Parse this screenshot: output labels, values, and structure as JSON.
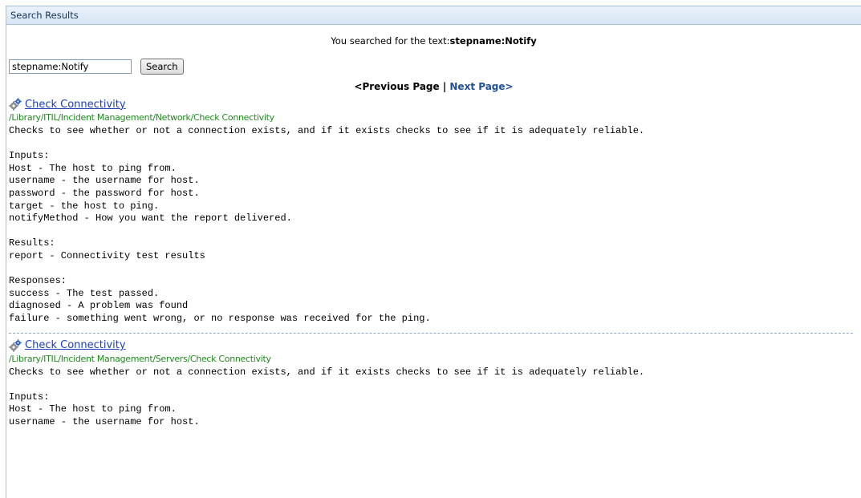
{
  "panel": {
    "title": "Search Results"
  },
  "search": {
    "info_prefix": "You searched for the text:",
    "query_text": "stepname:Notify",
    "input_value": "stepname:Notify",
    "button_label": "Search"
  },
  "pager": {
    "previous_label": "<Previous Page",
    "separator": " | ",
    "next_label": "Next Page>"
  },
  "results": [
    {
      "icon": "gear-icon",
      "title": "Check Connectivity",
      "path": "/Library/ITIL/Incident Management/Network/Check Connectivity",
      "description": "Checks to see whether or not a connection exists, and if it exists checks to see if it is adequately reliable.\n\nInputs:\nHost - The host to ping from.\nusername - the username for host.\npassword - the password for host.\ntarget - the host to ping.\nnotifyMethod - How you want the report delivered.\n\nResults:\nreport - Connectivity test results\n\nResponses:\nsuccess - The test passed.\ndiagnosed - A problem was found\nfailure - something went wrong, or no response was received for the ping."
    },
    {
      "icon": "gear-icon",
      "title": "Check Connectivity",
      "path": "/Library/ITIL/Incident Management/Servers/Check Connectivity",
      "description": "Checks to see whether or not a connection exists, and if it exists checks to see if it is adequately reliable.\n\nInputs:\nHost - The host to ping from.\nusername - the username for host."
    }
  ],
  "colors": {
    "header_bg": "#d7e5f4",
    "link": "#1c3fb7",
    "path": "#1f8a1f",
    "next_link": "#1f4f9a"
  }
}
